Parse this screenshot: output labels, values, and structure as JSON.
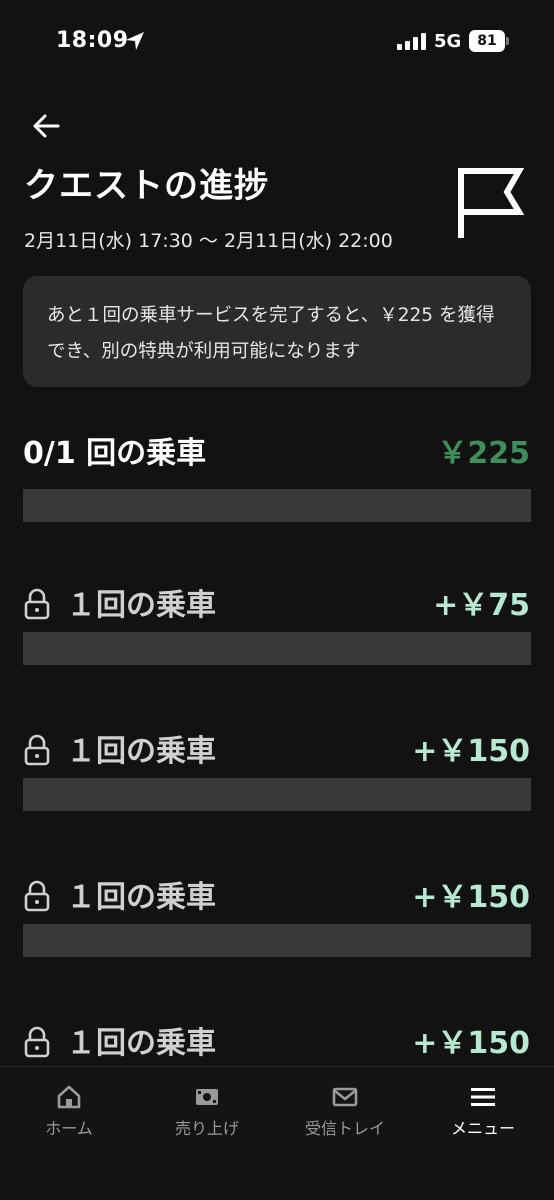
{
  "status_bar": {
    "time": "18:09",
    "network": "5G",
    "battery": "81"
  },
  "header": {
    "back_icon": "arrow-left-icon",
    "title": "クエストの進捗",
    "date_range": "2月11日(水) 17:30 〜 2月11日(水) 22:00",
    "flag_icon": "flag-icon"
  },
  "info": {
    "text": "あと１回の乗車サービスを完了すると、￥225 を獲得でき、別の特典が利用可能になります"
  },
  "progress": {
    "label": "0/1 回の乗車",
    "reward": "￥225",
    "fraction": 0
  },
  "tiers": [
    {
      "label": "１回の乗車",
      "reward": "+￥75",
      "icon": "lock-icon"
    },
    {
      "label": "１回の乗車",
      "reward": "+￥150",
      "icon": "lock-icon"
    },
    {
      "label": "１回の乗車",
      "reward": "+￥150",
      "icon": "lock-icon"
    },
    {
      "label": "１回の乗車",
      "reward": "+￥150",
      "icon": "lock-icon"
    }
  ],
  "nav": {
    "items": [
      {
        "label": "ホーム",
        "icon": "home-icon"
      },
      {
        "label": "売り上げ",
        "icon": "earnings-icon"
      },
      {
        "label": "受信トレイ",
        "icon": "mail-icon"
      },
      {
        "label": "メニュー",
        "icon": "menu-icon"
      }
    ],
    "active_index": 3
  },
  "colors": {
    "background": "#121212",
    "card": "#2b2b2b",
    "bar": "#393939",
    "reward_green": "#3f8f5c",
    "tier_reward_mint": "#b7e8d0"
  }
}
